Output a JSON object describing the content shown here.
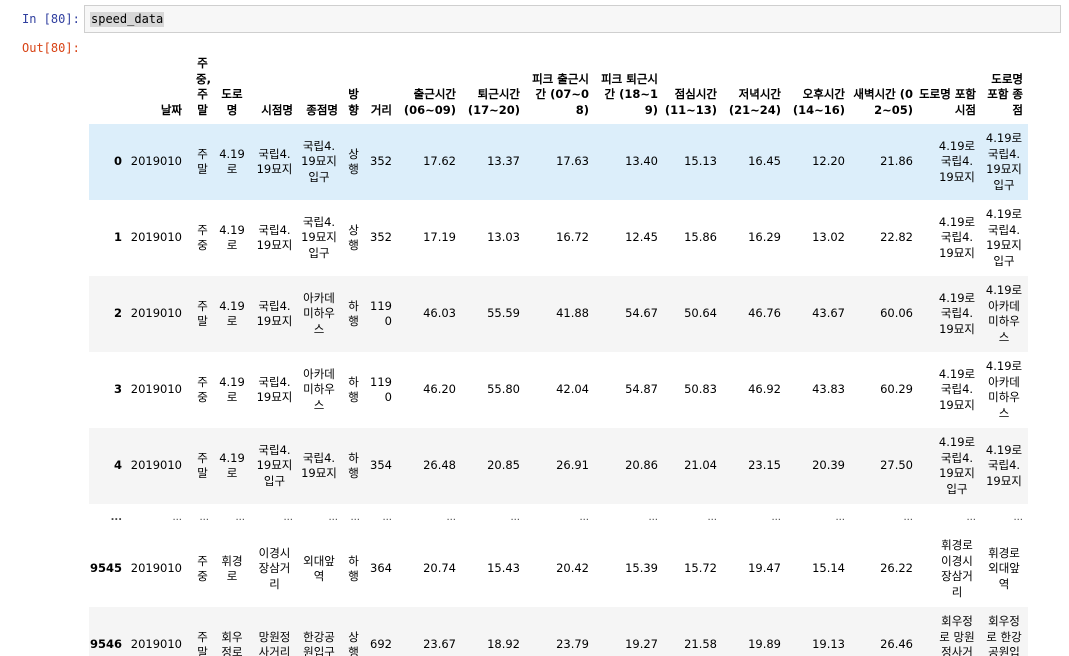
{
  "notebook": {
    "in_prompt": "In [80]:",
    "out_prompt": "Out[80]:",
    "code": "speed_data"
  },
  "dataframe": {
    "columns": [
      "",
      "날짜",
      "주중,주말",
      "도로명",
      "시점명",
      "종점명",
      "방향",
      "거리",
      "출근시간 (06~09)",
      "퇴근시간 (17~20)",
      "피크 출근시간 (07~08)",
      "피크 퇴근시간 (18~19)",
      "점심시간 (11~13)",
      "저녁시간 (21~24)",
      "오후시간 (14~16)",
      "새벽시간 (02~05)",
      "도로명 포함 시점",
      "도로명 포함 종점"
    ],
    "rows": [
      {
        "idx": "0",
        "date": "2019010",
        "daytype": "주말",
        "road": "4.19로",
        "from": "국립4.19묘지",
        "to": "국립4.19묘지입구",
        "dir": "상행",
        "dist": "352",
        "c1": "17.62",
        "c2": "13.37",
        "c3": "17.63",
        "c4": "13.40",
        "c5": "15.13",
        "c6": "16.45",
        "c7": "12.20",
        "c8": "21.86",
        "rfrom": "4.19로 국립4.19묘지",
        "rto": "4.19로 국립4.19묘지입구"
      },
      {
        "idx": "1",
        "date": "2019010",
        "daytype": "주중",
        "road": "4.19로",
        "from": "국립4.19묘지",
        "to": "국립4.19묘지입구",
        "dir": "상행",
        "dist": "352",
        "c1": "17.19",
        "c2": "13.03",
        "c3": "16.72",
        "c4": "12.45",
        "c5": "15.86",
        "c6": "16.29",
        "c7": "13.02",
        "c8": "22.82",
        "rfrom": "4.19로 국립4.19묘지",
        "rto": "4.19로 국립4.19묘지입구"
      },
      {
        "idx": "2",
        "date": "2019010",
        "daytype": "주말",
        "road": "4.19로",
        "from": "국립4.19묘지",
        "to": "아카데미하우스",
        "dir": "하행",
        "dist": "1190",
        "c1": "46.03",
        "c2": "55.59",
        "c3": "41.88",
        "c4": "54.67",
        "c5": "50.64",
        "c6": "46.76",
        "c7": "43.67",
        "c8": "60.06",
        "rfrom": "4.19로 국립4.19묘지",
        "rto": "4.19로 아카데미하우스"
      },
      {
        "idx": "3",
        "date": "2019010",
        "daytype": "주중",
        "road": "4.19로",
        "from": "국립4.19묘지",
        "to": "아카데미하우스",
        "dir": "하행",
        "dist": "1190",
        "c1": "46.20",
        "c2": "55.80",
        "c3": "42.04",
        "c4": "54.87",
        "c5": "50.83",
        "c6": "46.92",
        "c7": "43.83",
        "c8": "60.29",
        "rfrom": "4.19로 국립4.19묘지",
        "rto": "4.19로 아카데미하우스"
      },
      {
        "idx": "4",
        "date": "2019010",
        "daytype": "주말",
        "road": "4.19로",
        "from": "국립4.19묘지입구",
        "to": "국립4.19묘지",
        "dir": "하행",
        "dist": "354",
        "c1": "26.48",
        "c2": "20.85",
        "c3": "26.91",
        "c4": "20.86",
        "c5": "21.04",
        "c6": "23.15",
        "c7": "20.39",
        "c8": "27.50",
        "rfrom": "4.19로 국립4.19묘지입구",
        "rto": "4.19로 국립4.19묘지"
      },
      {
        "idx": "9545",
        "date": "2019010",
        "daytype": "주중",
        "road": "휘경로",
        "from": "이경시장삼거리",
        "to": "외대앞역",
        "dir": "하행",
        "dist": "364",
        "c1": "20.74",
        "c2": "15.43",
        "c3": "20.42",
        "c4": "15.39",
        "c5": "15.72",
        "c6": "19.47",
        "c7": "15.14",
        "c8": "26.22",
        "rfrom": "휘경로 이경시장삼거리",
        "rto": "휘경로 외대앞역"
      },
      {
        "idx": "9546",
        "date": "2019010",
        "daytype": "주말",
        "road": "회우정로",
        "from": "망원정사거리",
        "to": "한강공원입구",
        "dir": "상행",
        "dist": "692",
        "c1": "23.67",
        "c2": "18.92",
        "c3": "23.79",
        "c4": "19.27",
        "c5": "21.58",
        "c6": "19.89",
        "c7": "19.13",
        "c8": "26.46",
        "rfrom": "회우정로 망원정사거리",
        "rto": "회우정로 한강공원입구"
      }
    ],
    "ellipsis": "..."
  }
}
